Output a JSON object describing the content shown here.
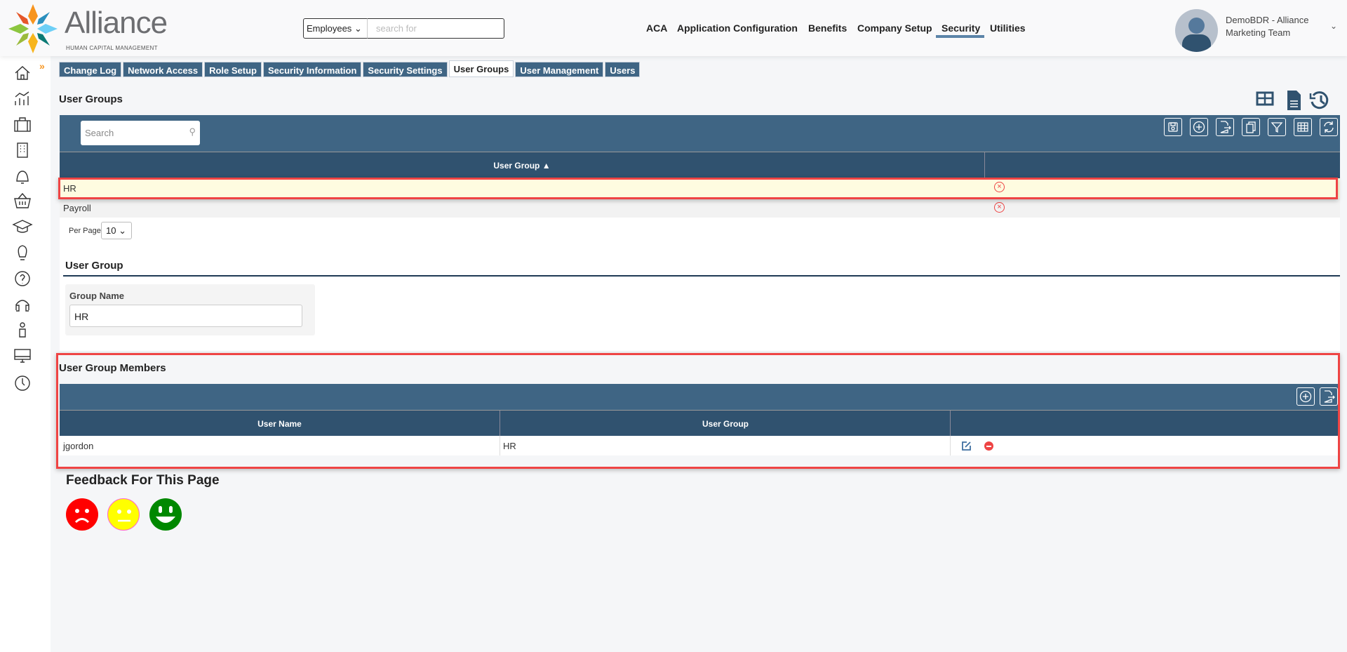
{
  "header": {
    "logo_name": "Alliance",
    "logo_tagline": "HUMAN CAPITAL MANAGEMENT",
    "search_scope": "Employees",
    "search_placeholder": "search for",
    "nav": [
      {
        "label": "ACA"
      },
      {
        "label": "Application Configuration"
      },
      {
        "label": "Benefits"
      },
      {
        "label": "Company Setup"
      },
      {
        "label": "Security",
        "active": true
      },
      {
        "label": "Utilities"
      }
    ],
    "user_line1": "DemoBDR - Alliance",
    "user_line2": "Marketing Team"
  },
  "sidebar": {
    "icons": [
      "home-icon",
      "analytics-icon",
      "briefcase-icon",
      "building-icon",
      "bell-icon",
      "basket-icon",
      "graduation-cap-icon",
      "lightbulb-icon",
      "help-icon",
      "headphones-icon",
      "person-icon",
      "monitor-icon",
      "clock-icon"
    ]
  },
  "tabs": [
    {
      "label": "Change Log"
    },
    {
      "label": "Network Access"
    },
    {
      "label": "Role Setup"
    },
    {
      "label": "Security Information"
    },
    {
      "label": "Security Settings"
    },
    {
      "label": "User Groups",
      "active": true
    },
    {
      "label": "User Management"
    },
    {
      "label": "Users"
    }
  ],
  "groups": {
    "title": "User Groups",
    "search_placeholder": "Search",
    "column": "User Group ▲",
    "rows": [
      {
        "name": "HR",
        "selected": true
      },
      {
        "name": "Payroll"
      }
    ],
    "per_page_label": "Per Page",
    "per_page": "10"
  },
  "form": {
    "title": "User Group",
    "field_label": "Group Name",
    "field_value": "HR"
  },
  "members": {
    "title": "User Group Members",
    "columns": [
      "User Name",
      "User Group"
    ],
    "rows": [
      {
        "user": "jgordon",
        "group": "HR"
      }
    ]
  },
  "feedback": {
    "title": "Feedback For This Page"
  },
  "colors": {
    "primary": "#3f6584",
    "header_row": "#30526f",
    "highlight": "#ef4444",
    "selected_row": "#fefce0"
  }
}
